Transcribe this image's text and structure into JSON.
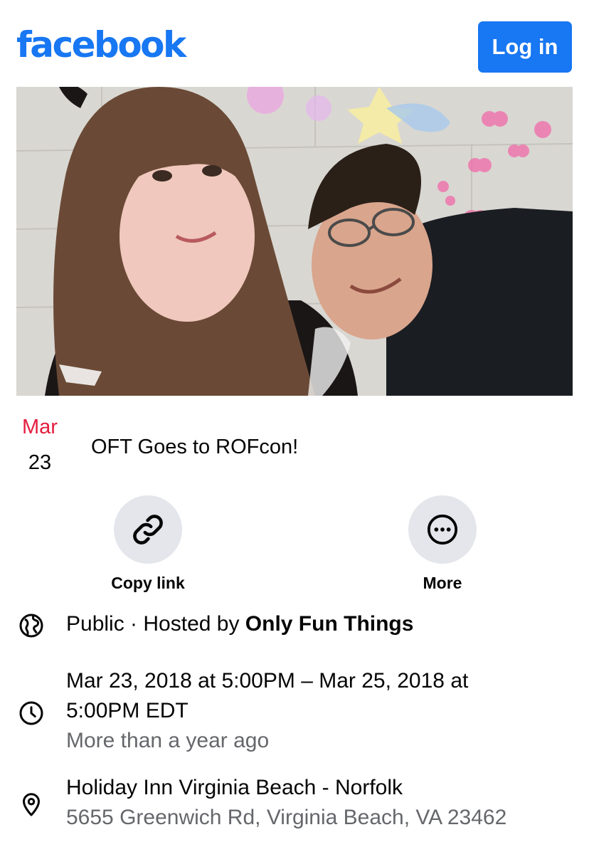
{
  "header": {
    "logo_text": "facebook",
    "login_label": "Log in",
    "brand_color": "#1877f2"
  },
  "cover": {
    "alt": "Cover photo"
  },
  "event": {
    "month": "Mar",
    "day": "23",
    "title": "OFT Goes to ROFcon!",
    "month_color": "#e41e3f"
  },
  "actions": [
    {
      "label": "Copy link",
      "icon": "link-icon"
    },
    {
      "label": "More",
      "icon": "more-icon"
    }
  ],
  "details": {
    "privacy": "Public",
    "hosted_prefix": " · Hosted by ",
    "host": "Only Fun Things",
    "privacy_icon": "globe-icon",
    "time_line1": "Mar 23, 2018 at 5:00PM – Mar 25, 2018 at",
    "time_line2": "5:00PM EDT",
    "time_relative": "More than a year ago",
    "time_icon": "clock-icon",
    "location_name": "Holiday Inn Virginia Beach - Norfolk",
    "location_address": "5655 Greenwich Rd, Virginia Beach, VA 23462",
    "location_icon": "location-pin-icon"
  }
}
